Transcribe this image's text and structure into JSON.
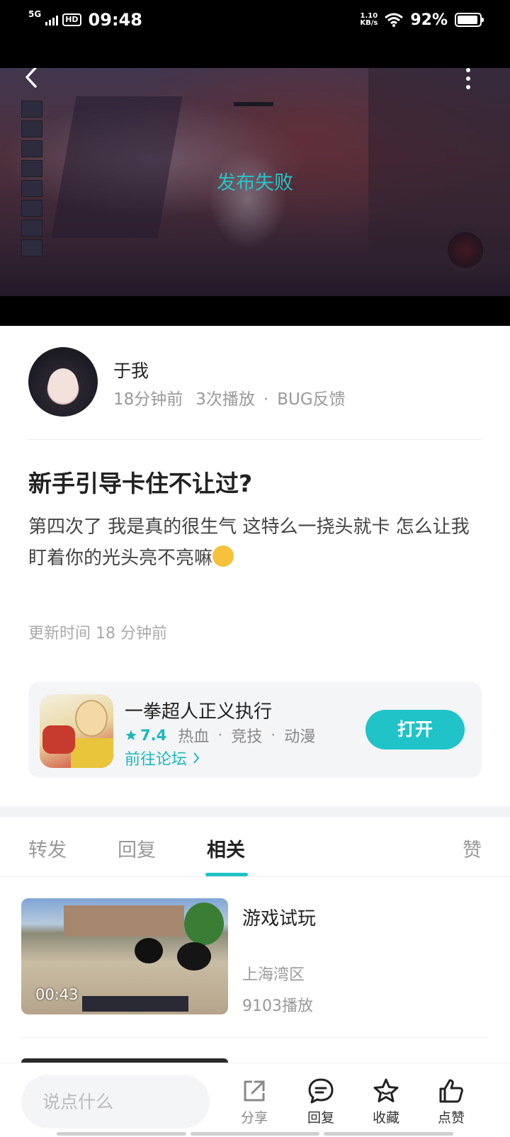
{
  "status_bar": {
    "network": "5G",
    "hd": "HD",
    "time": "09:48",
    "speed_value": "1.10",
    "speed_unit": "KB/s",
    "battery_percent": "92%",
    "battery_level": 0.92
  },
  "video": {
    "status_text": "发布失败",
    "back_icon": "chevron-left-icon",
    "more_icon": "more-vertical-icon"
  },
  "author": {
    "name": "于我",
    "time_ago": "18分钟前",
    "plays": "3次播放",
    "separator": "·",
    "category": "BUG反馈"
  },
  "post": {
    "title": "新手引导卡住不让过?",
    "body": "第四次了 我是真的很生气 这特么一挠头就卡 怎么让我盯着你的光头亮不亮嘛",
    "emoji": "upside-down-face-emoji",
    "update_time": "更新时间 18 分钟前"
  },
  "game": {
    "name": "一拳超人正义执行",
    "rating": "7.4",
    "tags": [
      "热血",
      "竞技",
      "动漫"
    ],
    "forum_link": "前往论坛",
    "open_button": "打开",
    "accent_color": "#1fc3c8"
  },
  "tabs": {
    "items": [
      "转发",
      "回复",
      "相关",
      "赞"
    ],
    "active": "相关"
  },
  "related": {
    "items": [
      {
        "title": "游戏试玩",
        "author": "上海湾区",
        "plays": "9103播放",
        "duration": "00:43"
      }
    ]
  },
  "bottom_bar": {
    "input_placeholder": "说点什么",
    "share": "分享",
    "reply": "回复",
    "favorite": "收藏",
    "like": "点赞"
  }
}
